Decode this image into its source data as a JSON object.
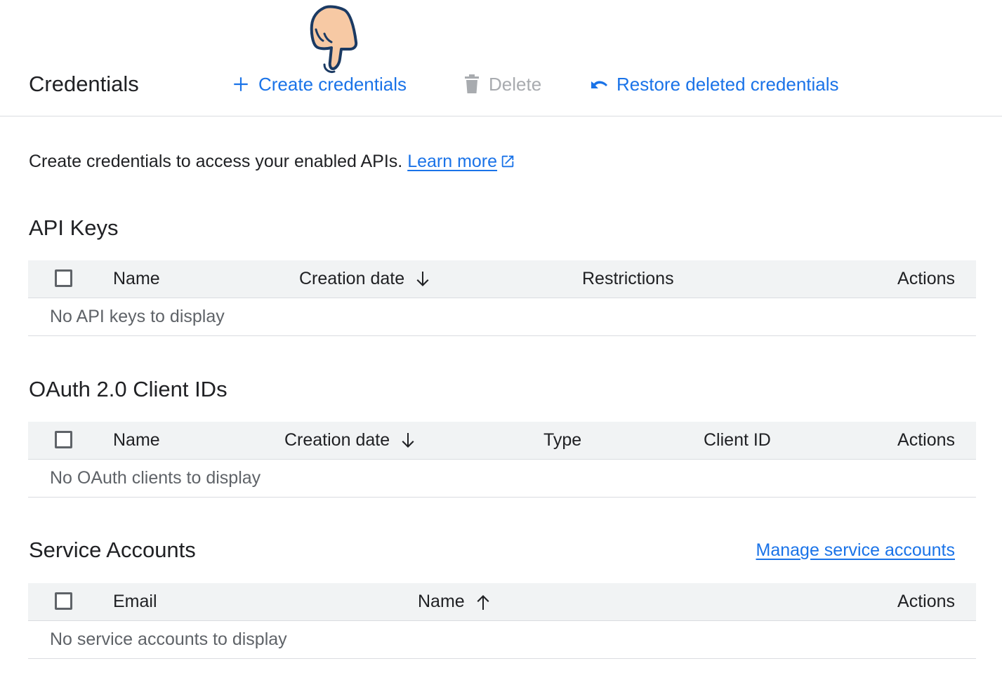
{
  "toolbar": {
    "title": "Credentials",
    "create_label": "Create credentials",
    "delete_label": "Delete",
    "restore_label": "Restore deleted credentials"
  },
  "intro": {
    "text": "Create credentials to access your enabled APIs. ",
    "learn_more": "Learn more"
  },
  "api_keys": {
    "title": "API Keys",
    "columns": [
      "Name",
      "Creation date",
      "Restrictions",
      "Actions"
    ],
    "sort_column": "Creation date",
    "sort_direction": "descending",
    "empty": "No API keys to display"
  },
  "oauth": {
    "title": "OAuth 2.0 Client IDs",
    "columns": [
      "Name",
      "Creation date",
      "Type",
      "Client ID",
      "Actions"
    ],
    "sort_column": "Creation date",
    "sort_direction": "descending",
    "empty": "No OAuth clients to display"
  },
  "service_accounts": {
    "title": "Service Accounts",
    "manage_link": "Manage service accounts",
    "columns": [
      "Email",
      "Name",
      "Actions"
    ],
    "sort_column": "Name",
    "sort_direction": "ascending",
    "empty": "No service accounts to display"
  },
  "colors": {
    "accent": "#1a73e8",
    "disabled": "#a8abaf",
    "header_bg": "#f1f3f4",
    "divider": "#dadce0"
  },
  "icons": [
    "plus-icon",
    "trash-icon",
    "undo-icon",
    "external-link-icon",
    "arrow-down-icon",
    "arrow-up-icon",
    "pointing-hand-icon"
  ]
}
